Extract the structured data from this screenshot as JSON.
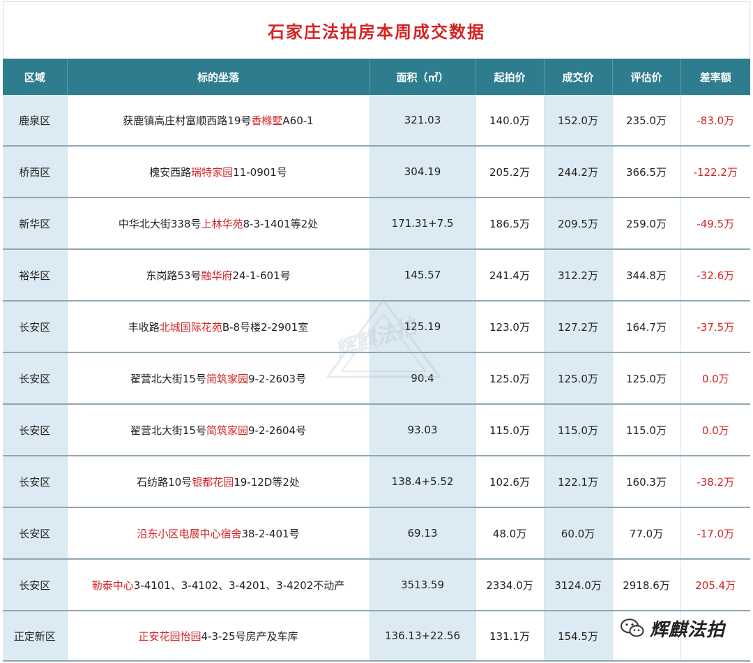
{
  "title": "石家庄法拍房本周成交数据",
  "headers": [
    "区域",
    "标的坐落",
    "面积（㎡）",
    "起拍价",
    "成交价",
    "评估价",
    "差率额"
  ],
  "rows": [
    {
      "district": "鹿泉区",
      "addr_pre": "获鹿镇高庄村富顺西路19号",
      "addr_hl": "香橼墅",
      "addr_post": "A60-1",
      "area": "321.03",
      "start": "140.0万",
      "deal": "152.0万",
      "appraisal": "235.0万",
      "diff": "-83.0万"
    },
    {
      "district": "桥西区",
      "addr_pre": "槐安西路",
      "addr_hl": "瑞特家园",
      "addr_post": "11-0901号",
      "area": "304.19",
      "start": "205.2万",
      "deal": "244.2万",
      "appraisal": "366.5万",
      "diff": "-122.2万"
    },
    {
      "district": "新华区",
      "addr_pre": "中华北大街338号",
      "addr_hl": "上林华苑",
      "addr_post": "8-3-1401等2处",
      "area": "171.31+7.5",
      "start": "186.5万",
      "deal": "209.5万",
      "appraisal": "259.0万",
      "diff": "-49.5万"
    },
    {
      "district": "裕华区",
      "addr_pre": "东岗路53号",
      "addr_hl": "融华府",
      "addr_post": "24-1-601号",
      "area": "145.57",
      "start": "241.4万",
      "deal": "312.2万",
      "appraisal": "344.8万",
      "diff": "-32.6万"
    },
    {
      "district": "长安区",
      "addr_pre": "丰收路",
      "addr_hl": "北城国际花苑",
      "addr_post": "B-8号楼2-2901室",
      "area": "125.19",
      "start": "123.0万",
      "deal": "127.2万",
      "appraisal": "164.7万",
      "diff": "-37.5万"
    },
    {
      "district": "长安区",
      "addr_pre": "翟营北大街15号",
      "addr_hl": "简筑家园",
      "addr_post": "9-2-2603号",
      "area": "90.4",
      "start": "125.0万",
      "deal": "125.0万",
      "appraisal": "125.0万",
      "diff": "0.0万"
    },
    {
      "district": "长安区",
      "addr_pre": "翟营北大街15号",
      "addr_hl": "简筑家园",
      "addr_post": "9-2-2604号",
      "area": "93.03",
      "start": "115.0万",
      "deal": "115.0万",
      "appraisal": "115.0万",
      "diff": "0.0万"
    },
    {
      "district": "长安区",
      "addr_pre": "石纺路10号",
      "addr_hl": "银都花园",
      "addr_post": "19-12D等2处",
      "area": "138.4+5.52",
      "start": "102.6万",
      "deal": "122.1万",
      "appraisal": "160.3万",
      "diff": "-38.2万"
    },
    {
      "district": "长安区",
      "addr_pre": "",
      "addr_hl": "沿东小区电展中心宿舍",
      "addr_post": "38-2-401号",
      "area": "69.13",
      "start": "48.0万",
      "deal": "60.0万",
      "appraisal": "77.0万",
      "diff": "-17.0万"
    },
    {
      "district": "长安区",
      "addr_pre": "",
      "addr_hl": "勒泰中心",
      "addr_post": "3-4101、3-4102、3-4201、3-4202不动产",
      "area": "3513.59",
      "start": "2334.0万",
      "deal": "3124.0万",
      "appraisal": "2918.6万",
      "diff": "205.4万"
    },
    {
      "district": "正定新区",
      "addr_pre": "",
      "addr_hl": "正安花园怡园",
      "addr_post": "4-3-25号房产及车库",
      "area": "136.13+22.56",
      "start": "131.1万",
      "deal": "154.5万",
      "appraisal": "",
      "diff": ""
    }
  ],
  "watermark": "辉麒法拍",
  "brand": "辉麒法拍",
  "colors": {
    "title": "#d42424",
    "header_bg": "#2e7d8f",
    "header_text": "#ffffff",
    "highlight_col_bg": "#dcebf3",
    "accent_red": "#d42424"
  }
}
